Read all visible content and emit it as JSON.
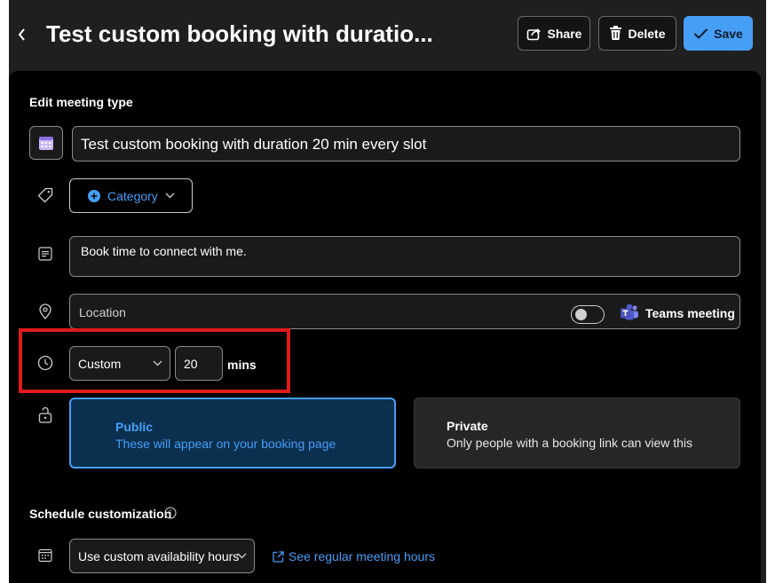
{
  "header": {
    "title": "Test custom booking with duratio...",
    "share_label": "Share",
    "delete_label": "Delete",
    "save_label": "Save"
  },
  "edit_section": {
    "heading": "Edit meeting type",
    "title_value": "Test custom booking with duration 20 min every slot",
    "category_label": "Category",
    "description_value": "Book time to connect with me.",
    "location_placeholder": "Location",
    "teams_label": "Teams meeting",
    "teams_enabled": false,
    "duration_option": "Custom",
    "duration_value": "20",
    "duration_unit": "mins",
    "visibility": {
      "public_title": "Public",
      "public_desc": "These will appear on your booking page",
      "private_title": "Private",
      "private_desc": "Only people with a booking link can view this",
      "selected": "Public"
    }
  },
  "schedule_section": {
    "heading": "Schedule customization",
    "availability_option": "Use custom availability hours",
    "regular_hours_link": "See regular meeting hours"
  },
  "colors": {
    "accent": "#479ef5",
    "highlight_box": "#e01b1b",
    "panel_bg": "#000000",
    "header_bg": "#1f1f1f"
  }
}
